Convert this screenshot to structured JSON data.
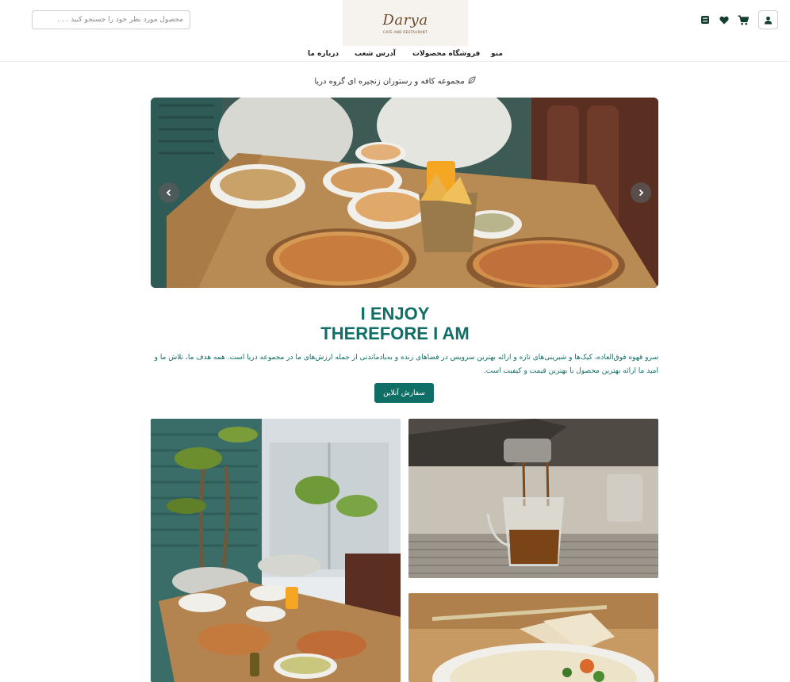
{
  "header": {
    "search_placeholder": "محصول مورد نظر خود را جستجو کنید . . .",
    "logo": {
      "name": "Darya",
      "tagline": "CAFE AND RESTAURANT"
    },
    "icons": [
      "user-icon",
      "cart-icon",
      "heart-icon",
      "compare-icon"
    ]
  },
  "nav": {
    "items": [
      {
        "label": "منو"
      },
      {
        "label": "فروشگاه محصولات"
      },
      {
        "label": "آدرس شعب"
      },
      {
        "label": "درباره ما"
      }
    ]
  },
  "tagline": {
    "text": "مجموعه کافه و رستوران زنجیره ای گروه دریا",
    "icon": "leaf-icon"
  },
  "hero": {
    "image": "restaurant table with pizzas, salads and orange juice",
    "arrows": [
      "chevron-left-icon",
      "chevron-right-icon"
    ]
  },
  "intro": {
    "headline_line1": "I ENJOY",
    "headline_line2": "THEREFORE I AM",
    "description": "سرو قهوه فوق‌العاده، کیک‌ها و شیرینی‌های تازه و ارائه بهترین سرویس در فضاهای زنده و به‌یادماندنی از جمله ارزش‌های ما در مجموعه دریا است. همه هدف ما، تلاش ما و امید ما ارائه بهترین محصول با بهترین قیمت و کیفیت است.",
    "cta_label": "سفارش آنلاین"
  },
  "gallery": [
    {
      "image": "restaurant interior with plants and table of food"
    },
    {
      "image": "espresso machine pouring coffee"
    },
    {
      "image": "plate of salad with crackers"
    }
  ],
  "colors": {
    "accent": "#0f6e66",
    "logo_brown": "#6b4a2b"
  }
}
